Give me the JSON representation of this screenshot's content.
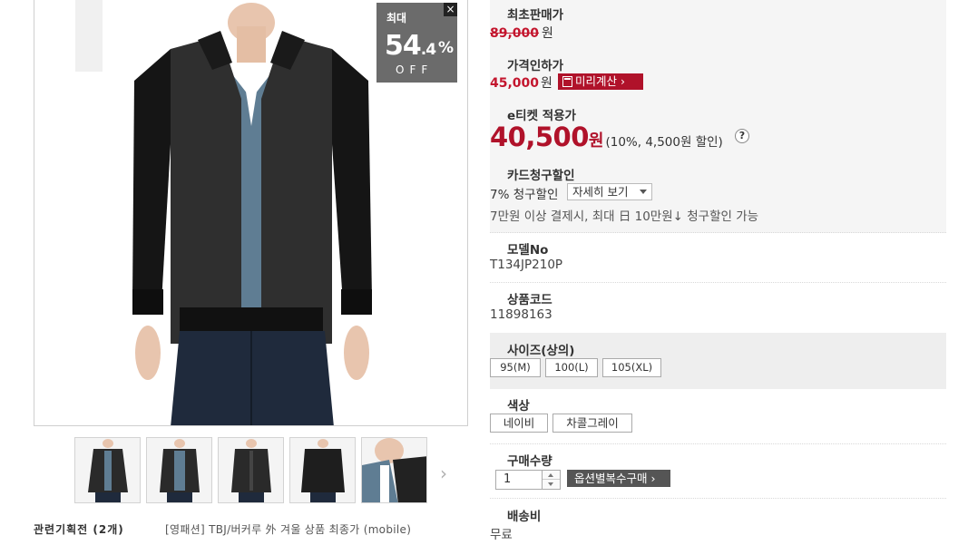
{
  "product_image": {
    "alt": "black wool bomber jacket on mannequin"
  },
  "discount_badge": {
    "label": "최대",
    "number": "54",
    "decimal": ".4",
    "percent": "%",
    "off": "OFF",
    "close": "×"
  },
  "thumbnails": [
    {
      "alt": "jacket front view"
    },
    {
      "alt": "jacket front view open"
    },
    {
      "alt": "jacket front view zipped"
    },
    {
      "alt": "jacket back view"
    },
    {
      "alt": "jacket collar detail"
    }
  ],
  "thumb_next": "›",
  "related": {
    "title": "관련기획전 (2개)",
    "link": "[영패션] TBJ/버커루 外 겨울 상품 최종가 (mobile)"
  },
  "price": {
    "original_label": "최초판매가",
    "original_value": "89,000",
    "won": "원",
    "reduced_label": "가격인하가",
    "reduced_value": "45,000",
    "calc_button": "미리계산 ›",
    "eticket_label": "e티켓 적용가",
    "eticket_value": "40,500",
    "eticket_note": "(10%, 4,500원 할인)",
    "help": "?"
  },
  "card": {
    "label": "카드청구할인",
    "discount": "7% 청구할인",
    "detail_select": "자세히 보기",
    "note": "7만원 이상 결제시, 최대 日 10만원↓ 청구할인 가능"
  },
  "model": {
    "label": "모델No",
    "value": "T134JP210P"
  },
  "code": {
    "label": "상품코드",
    "value": "11898163"
  },
  "size": {
    "label": "사이즈(상의)",
    "options": [
      "95(M)",
      "100(L)",
      "105(XL)"
    ]
  },
  "color": {
    "label": "색상",
    "options": [
      "네이비",
      "차콜그레이"
    ]
  },
  "quantity": {
    "label": "구매수량",
    "value": "1",
    "multi_buy_button": "옵션별복수구매 ›"
  },
  "shipping": {
    "label": "배송비",
    "value": "무료"
  },
  "colors": {
    "accent": "#b0122a",
    "badge": "#6b6b6b",
    "panel": "#f5f5f5",
    "size_panel": "#eeeeee"
  }
}
